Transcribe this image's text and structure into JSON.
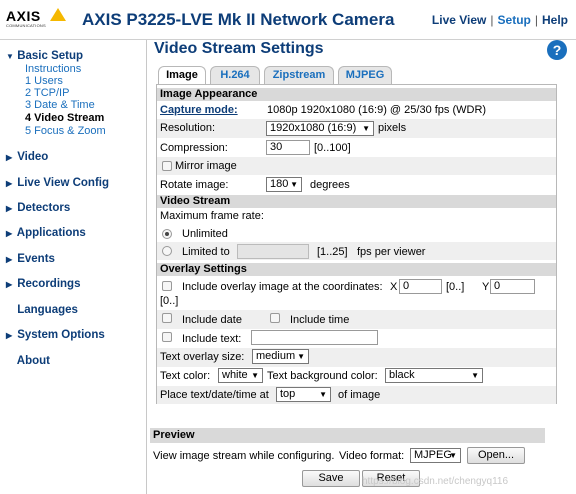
{
  "header": {
    "logo_text": "AXIS",
    "logo_sub": "COMMUNICATIONS",
    "title": "AXIS P3225-LVE Mk II Network Camera",
    "nav": [
      "Live View",
      "Setup",
      "Help"
    ]
  },
  "sidebar": {
    "basic_setup": "Basic Setup",
    "basic_items": [
      "Instructions",
      "1 Users",
      "2 TCP/IP",
      "3 Date & Time",
      "4 Video Stream",
      "5 Focus & Zoom"
    ],
    "sections": [
      "Video",
      "Live View Config",
      "Detectors",
      "Applications",
      "Events",
      "Recordings",
      "Languages",
      "System Options",
      "About"
    ]
  },
  "page": {
    "title": "Video Stream Settings",
    "help": "?",
    "tabs": [
      "Image",
      "H.264",
      "Zipstream",
      "MJPEG"
    ]
  },
  "image_appearance": {
    "heading": "Image Appearance",
    "capture_mode_label": "Capture mode:",
    "capture_mode_value": "1080p 1920x1080 (16:9) @ 25/30 fps (WDR)",
    "resolution_label": "Resolution:",
    "resolution_value": "1920x1080 (16:9)",
    "resolution_unit": "pixels",
    "compression_label": "Compression:",
    "compression_value": "30",
    "compression_range": "[0..100]",
    "mirror_label": "Mirror image",
    "rotate_label": "Rotate image:",
    "rotate_value": "180",
    "rotate_unit": "degrees"
  },
  "video_stream": {
    "heading": "Video Stream",
    "max_frame_rate_label": "Maximum frame rate:",
    "unlimited_label": "Unlimited",
    "limited_label": "Limited to",
    "limited_range": "[1..25]",
    "limited_unit": "fps per viewer"
  },
  "overlay": {
    "heading": "Overlay Settings",
    "include_image_label": "Include overlay image at the coordinates:",
    "x_label": "X",
    "x_value": "0",
    "x_range": "[0..]",
    "y_label": "Y",
    "y_value": "0",
    "y_range": "[0..]",
    "include_date_label": "Include date",
    "include_time_label": "Include time",
    "include_text_label": "Include text:",
    "text_size_label": "Text overlay size:",
    "text_size_value": "medium",
    "text_color_label": "Text color:",
    "text_color_value": "white",
    "bg_color_label": "Text background color:",
    "bg_color_value": "black",
    "place_label": "Place text/date/time at",
    "place_value": "top",
    "place_unit": "of image"
  },
  "preview": {
    "heading": "Preview",
    "text": "View image stream while configuring.",
    "format_label": "Video format:",
    "format_value": "MJPEG",
    "open_button": "Open..."
  },
  "buttons": {
    "save": "Save",
    "reset": "Reset"
  },
  "watermark": "https://blog.csdn.net/chengyq116",
  "colors": {
    "brand_blue": "#0d3d78",
    "link_blue": "#1a6fbd",
    "section_gray": "#d9d9d9",
    "logo_yellow": "#f5b800"
  }
}
